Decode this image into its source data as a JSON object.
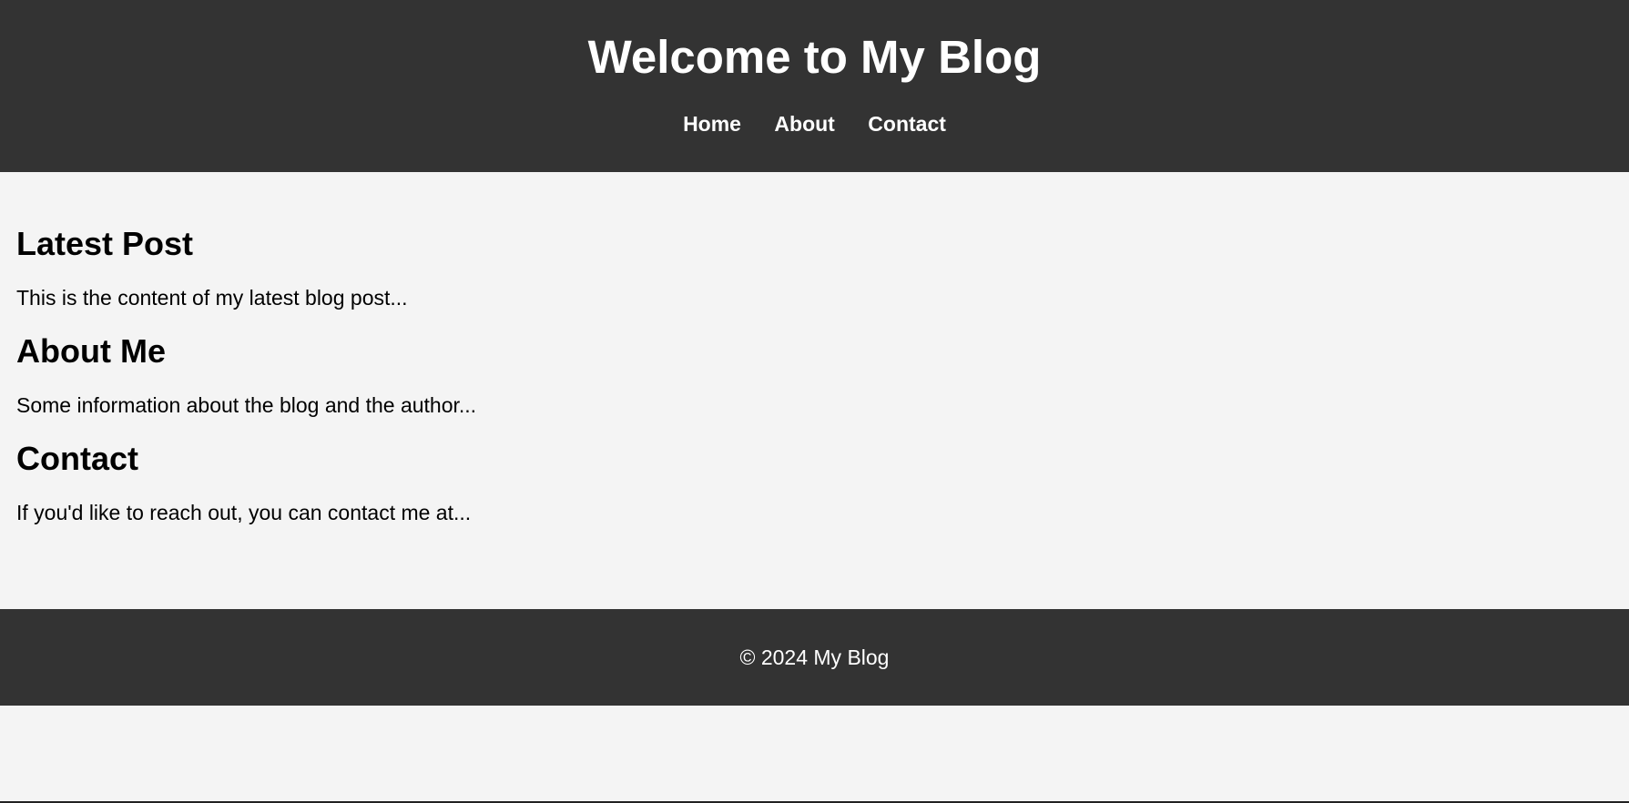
{
  "header": {
    "title": "Welcome to My Blog",
    "nav": [
      {
        "label": "Home"
      },
      {
        "label": "About"
      },
      {
        "label": "Contact"
      }
    ]
  },
  "sections": [
    {
      "heading": "Latest Post",
      "text": "This is the content of my latest blog post..."
    },
    {
      "heading": "About Me",
      "text": "Some information about the blog and the author..."
    },
    {
      "heading": "Contact",
      "text": "If you'd like to reach out, you can contact me at..."
    }
  ],
  "footer": {
    "text": "© 2024 My Blog"
  },
  "colors": {
    "header_bg": "#333333",
    "page_bg": "#f4f4f4",
    "footer_bg": "#333333",
    "header_text": "#ffffff"
  }
}
